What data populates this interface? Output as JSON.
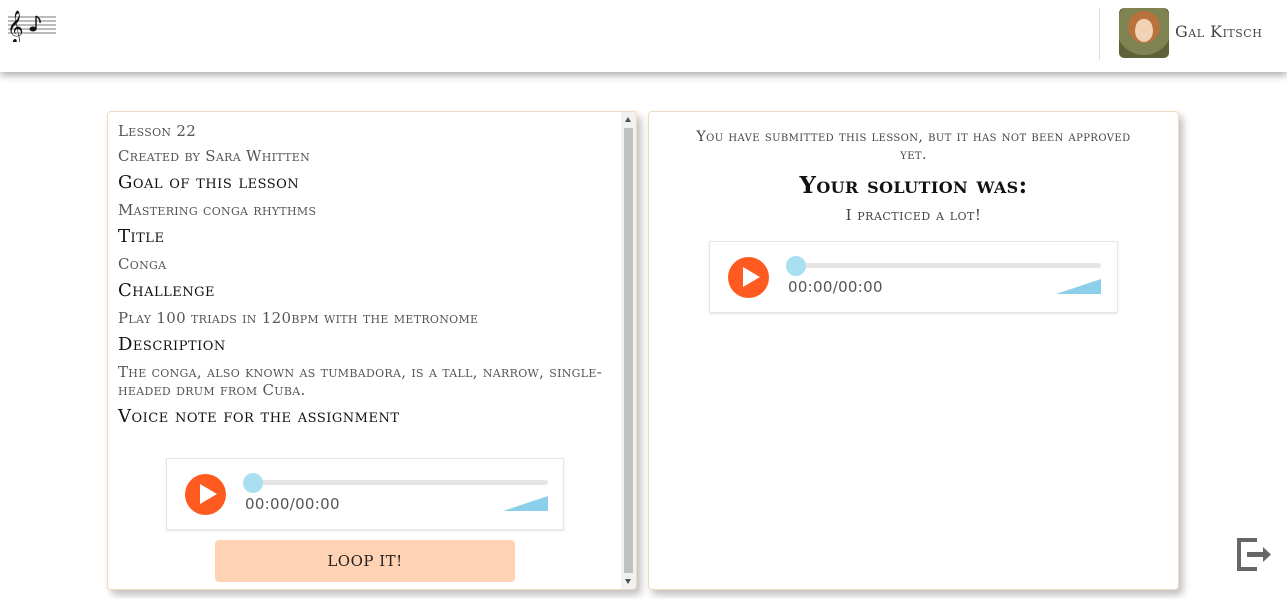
{
  "user": {
    "name": "Gal Kitsch"
  },
  "lesson": {
    "number_label": "Lesson 22",
    "created_by": "Created by Sara Whitten",
    "goal_heading": "Goal of this lesson",
    "goal": "Mastering conga rhythms",
    "title_heading": "Title",
    "title": "Conga",
    "challenge_heading": "Challenge",
    "challenge": "Play 100 triads in 120bpm with the metronome",
    "description_heading": "Description",
    "description": "The conga, also known as tumbadora, is a tall, narrow, single-headed drum from Cuba.",
    "voice_note_heading": "Voice note for the assignment",
    "voice_note_time": "00:00/00:00",
    "loop_button": "LOOP IT!"
  },
  "submission": {
    "status": "You have submitted this lesson, but it has not been approved yet.",
    "solution_heading": "Your solution was:",
    "solution_text": "I practiced a lot!",
    "audio_time": "00:00/00:00"
  },
  "icons": {
    "logo": "music-staff-icon",
    "play": "play-icon",
    "volume": "volume-icon",
    "logout": "logout-icon"
  },
  "colors": {
    "play_button": "#ff5a1f",
    "progress_knob": "#a8dff1",
    "loop_button": "#ffd2b3",
    "panel_border": "#f2d8bf"
  }
}
